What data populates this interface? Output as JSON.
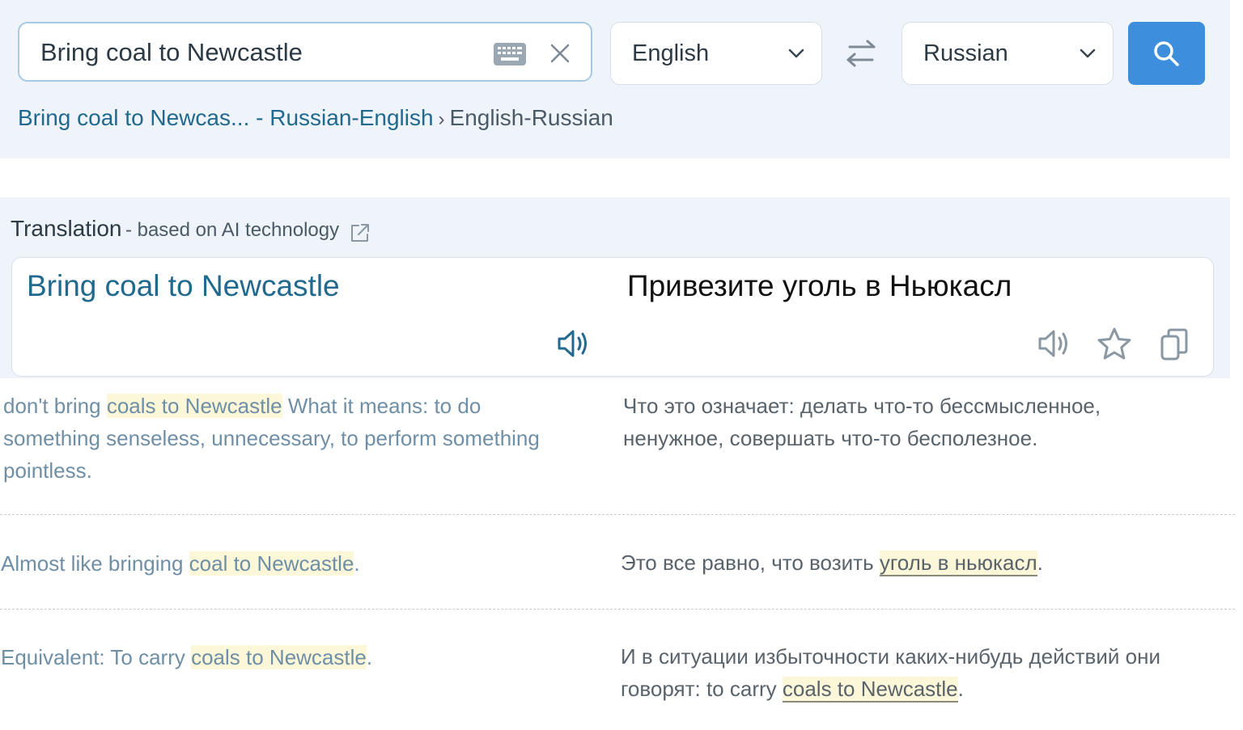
{
  "search": {
    "value": "Bring coal to Newcastle",
    "source_language": "English",
    "target_language": "Russian"
  },
  "breadcrumb": {
    "link": "Bring coal to Newcas... - Russian-English",
    "current": "English-Russian"
  },
  "translation": {
    "title": "Translation",
    "subtitle": "- based on AI technology",
    "source": "Bring coal to Newcastle",
    "target": "Привезите уголь в Ньюкасл"
  },
  "examples": [
    {
      "en_prefix": "don't bring ",
      "en_highlight": "coals to Newcastle",
      "en_suffix": " What it means: to do something senseless, unnecessary, to perform something pointless.",
      "ru_prefix": "Что это означает: делать что-то бессмысленное, ненужное, совершать что-то бесполезное.",
      "ru_highlight": "",
      "ru_suffix": ""
    },
    {
      "en_prefix": "Almost like bringing ",
      "en_highlight": "coal to Newcastle",
      "en_suffix": ".",
      "ru_prefix": "Это все равно, что возить ",
      "ru_highlight": "уголь в ньюкасл",
      "ru_suffix": "."
    },
    {
      "en_prefix": "Equivalent: To carry ",
      "en_highlight": "coals to Newcastle",
      "en_suffix": ".",
      "ru_prefix": "И в ситуации избыточности каких-нибудь действий они говорят: to carry ",
      "ru_highlight": "coals to Newcastle",
      "ru_suffix": "."
    }
  ],
  "colors": {
    "accent": "#3d8fdd",
    "link": "#21698e",
    "band": "#eef4fa",
    "highlight": "#fbf7d8"
  },
  "icons": [
    "keyboard-icon",
    "close-icon",
    "chevron-down-icon",
    "swap-icon",
    "search-icon",
    "external-link-icon",
    "speaker-icon",
    "star-icon",
    "copy-icon"
  ]
}
